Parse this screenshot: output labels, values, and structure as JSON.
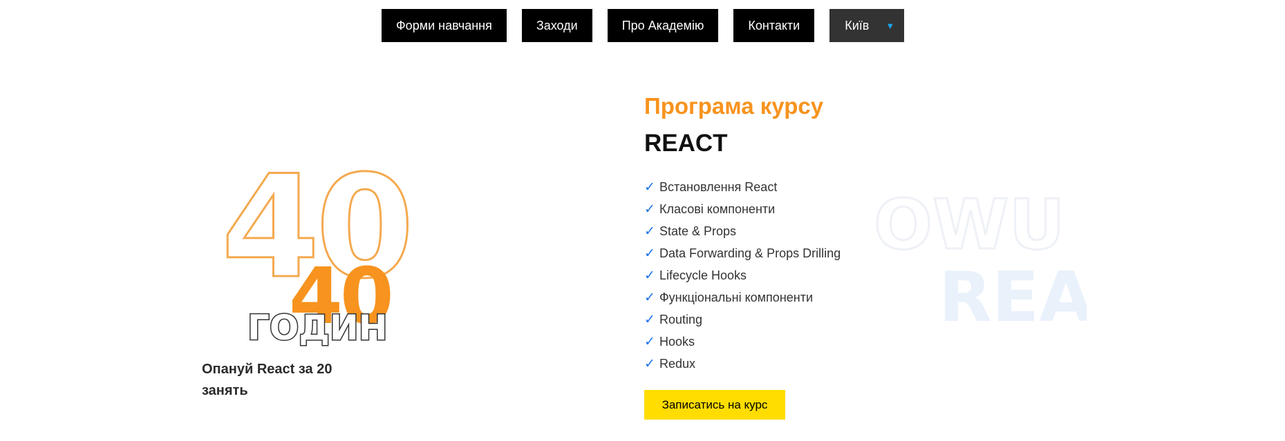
{
  "nav": {
    "items": [
      {
        "label": "Форми навчання"
      },
      {
        "label": "Заходи"
      },
      {
        "label": "Про Академію"
      },
      {
        "label": "Контакти"
      }
    ],
    "city": {
      "label": "Київ",
      "caret": "▼"
    }
  },
  "hero": {
    "big_number": "40",
    "small_number": "40",
    "unit_word": "ГОДИН",
    "caption": "Опануй React за 20 занять",
    "colors": {
      "orange": "#f7931e",
      "outline": "#f4a94f"
    }
  },
  "program": {
    "title": "Програма курсу",
    "course": "REACT",
    "topics": [
      "Встановлення React",
      "Класові компоненти",
      "State & Props",
      "Data Forwarding & Props Drilling",
      "Lifecycle Hooks",
      "Функціональні компоненти",
      "Routing",
      "Hooks",
      "Redux"
    ],
    "check_icon": "✓",
    "cta_label": "Записатись на курс"
  },
  "watermark": {
    "line1": "OWU",
    "line2": "REA"
  }
}
